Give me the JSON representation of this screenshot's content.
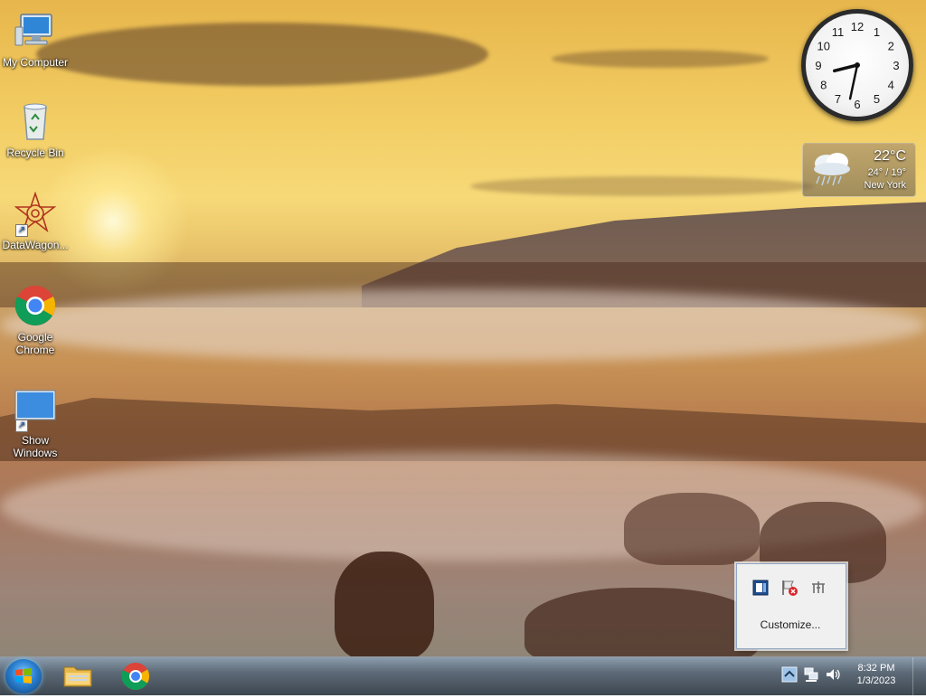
{
  "desktop": {
    "icons": [
      {
        "label": "My Computer",
        "icon": "computer-icon"
      },
      {
        "label": "Recycle Bin",
        "icon": "recycle-bin-icon"
      },
      {
        "label": "DataWagon...",
        "icon": "datawagon-icon"
      },
      {
        "label": "Google Chrome",
        "icon": "chrome-icon"
      },
      {
        "label": "Show Windows",
        "icon": "show-windows-icon"
      }
    ]
  },
  "gadgets": {
    "clock": {
      "numerals": [
        "12",
        "1",
        "2",
        "3",
        "4",
        "5",
        "6",
        "7",
        "8",
        "9",
        "10",
        "11"
      ],
      "time": "8:32"
    },
    "weather": {
      "temperature": "22°C",
      "range": "24° / 19°",
      "city": "New York",
      "icon": "rain-cloud-icon"
    }
  },
  "tray_popup": {
    "icons": [
      "app-tray-icon",
      "action-center-flag-icon",
      "usb-device-icon"
    ],
    "customize_label": "Customize..."
  },
  "taskbar": {
    "start_icon": "windows-start-icon",
    "pinned": [
      {
        "name": "file-explorer-icon"
      },
      {
        "name": "chrome-icon"
      }
    ],
    "tray": [
      "show-hidden-icons-icon",
      "network-icon",
      "volume-icon"
    ],
    "time": "8:32 PM",
    "date": "1/3/2023"
  },
  "colors": {
    "taskbar": "#3a4a5a",
    "popup_bg": "#f0f0f0",
    "link_blue": "#1a5fc0"
  }
}
